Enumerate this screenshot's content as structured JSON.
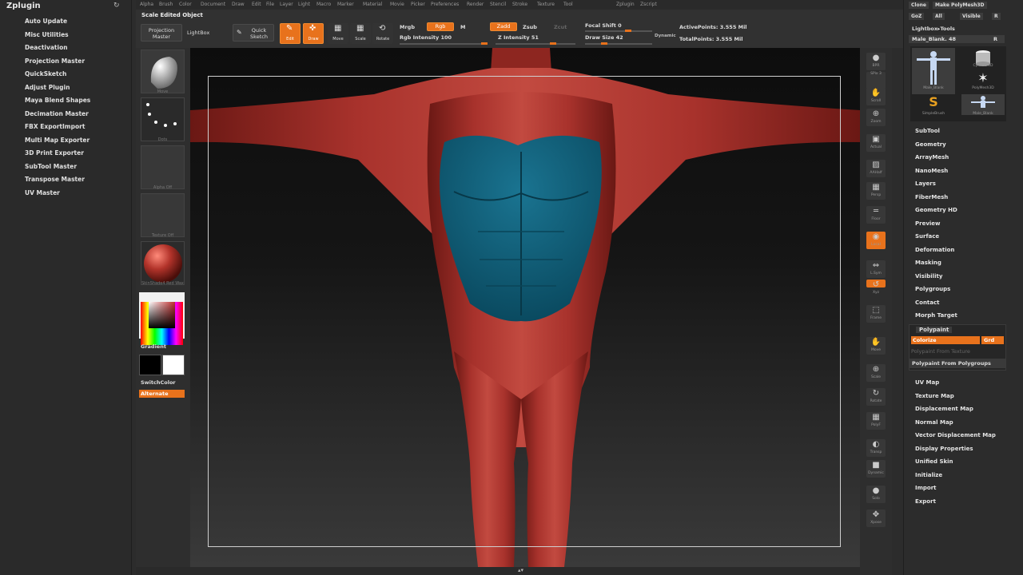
{
  "left": {
    "title": "Zplugin",
    "ctrl": "↻",
    "items": [
      "Auto Update",
      "Misc Utilities",
      "Deactivation",
      "Projection Master",
      "QuickSketch",
      "Adjust Plugin",
      "Maya Blend Shapes",
      "Decimation Master",
      "FBX ExportImport",
      "Multi Map Exporter",
      "3D Print Exporter",
      "SubTool Master",
      "Transpose Master",
      "UV Master"
    ]
  },
  "menubar": [
    "Alpha",
    "Brush",
    "Color",
    "Document",
    "Draw",
    "Edit",
    "File",
    "Layer",
    "Light",
    "Macro",
    "Marker",
    "Material",
    "Movie",
    "Picker",
    "Preferences",
    "Render",
    "Stencil",
    "Stroke",
    "Texture",
    "Tool",
    "Zplugin",
    "Zscript"
  ],
  "toolbar": {
    "status": "Scale Edited Object",
    "projection_master": "Projection Master",
    "lightbox": "LightBox",
    "quick_sketch": "Quick Sketch",
    "edit": "Edit",
    "draw": "Draw",
    "move": "Move",
    "scale": "Scale",
    "rotate": "Rotate",
    "mrgb": "Mrgb",
    "rgb": "Rgb",
    "m": "M",
    "rgb_intensity": "Rgb Intensity 100",
    "zadd": "Zadd",
    "zsub": "Zsub",
    "zcut": "Zcut",
    "z_intensity": "Z Intensity 51",
    "focal_shift": "Focal Shift 0",
    "draw_size": "Draw Size 42",
    "dynamic": "Dynamic",
    "active_points": "ActivePoints: 3.555 Mil",
    "total_points": "TotalPoints: 3.555 Mil"
  },
  "tools": {
    "thumb_labels": [
      "Move",
      "Dots",
      "Alpha Off",
      "Texture Off",
      "SkinShade4 Red Wax"
    ],
    "gradient": "Gradient",
    "switch_color": "SwitchColor",
    "alternate": "Alternate"
  },
  "icons": [
    {
      "name": "bpr-icon",
      "label": "BPR",
      "glyph": "●"
    },
    {
      "name": "spix-icon",
      "label": "SPix 3",
      "glyph": ""
    },
    {
      "name": "scroll-icon",
      "label": "Scroll",
      "glyph": "✋"
    },
    {
      "name": "zoom-icon",
      "label": "Zoom",
      "glyph": "⊕"
    },
    {
      "name": "actual-icon",
      "label": "Actual",
      "glyph": "▣"
    },
    {
      "name": "aahalf-icon",
      "label": "AAHalf",
      "glyph": "▨"
    },
    {
      "name": "persp-icon",
      "label": "Persp",
      "glyph": "▦"
    },
    {
      "name": "floor-icon",
      "label": "Floor",
      "glyph": "═"
    },
    {
      "name": "local-icon",
      "label": "Local",
      "glyph": "◉"
    },
    {
      "name": "lsym-icon",
      "label": "L.Sym",
      "glyph": "⇔"
    },
    {
      "name": "xyz-icon",
      "label": "Xyz",
      "glyph": "↺"
    },
    {
      "name": "frame-icon",
      "label": "Frame",
      "glyph": "⬚"
    },
    {
      "name": "move-icon",
      "label": "Move",
      "glyph": "✋"
    },
    {
      "name": "scale-icon",
      "label": "Scale",
      "glyph": "⊕"
    },
    {
      "name": "rotate-icon",
      "label": "Rotate",
      "glyph": "↻"
    },
    {
      "name": "polyf-icon",
      "label": "PolyF",
      "glyph": "▦"
    },
    {
      "name": "transp-icon",
      "label": "Transp",
      "glyph": "◐"
    },
    {
      "name": "dynamic-icon",
      "label": "Dynamic",
      "glyph": "■"
    },
    {
      "name": "solo-icon",
      "label": "Solo",
      "glyph": "●"
    },
    {
      "name": "xpose-icon",
      "label": "Xpose",
      "glyph": "✥"
    }
  ],
  "right": {
    "top_buttons": [
      "Clone",
      "Make PolyMesh3D",
      "GoZ",
      "All",
      "Visible",
      "R"
    ],
    "lightbox_tools": "Lightbox▸Tools",
    "tool_name": "Male_Blank. 48",
    "r": "R",
    "thumbs": [
      "Male_Blank",
      "Cylinder3D",
      "PolyMesh3D",
      "SimpleBrush",
      "Male_Blank"
    ],
    "subpalettes_1": [
      "SubTool",
      "Geometry",
      "ArrayMesh",
      "NanoMesh",
      "Layers",
      "FiberMesh",
      "Geometry HD",
      "Preview",
      "Surface",
      "Deformation",
      "Masking",
      "Visibility",
      "Polygroups",
      "Contact",
      "Morph Target"
    ],
    "polypaint": "Polypaint",
    "colorize": "Colorize",
    "grd": "Grd",
    "pp_from_texture": "Polypaint From Texture",
    "pp_from_polygroups": "Polypaint From Polygroups",
    "subpalettes_2": [
      "UV Map",
      "Texture Map",
      "Displacement Map",
      "Normal Map",
      "Vector Displacement Map",
      "Display Properties",
      "Unified Skin",
      "Initialize",
      "Import",
      "Export"
    ]
  },
  "colors": {
    "accent": "#e8721c",
    "skin": "#a8322c",
    "polypaint": "#0e5f7a"
  }
}
